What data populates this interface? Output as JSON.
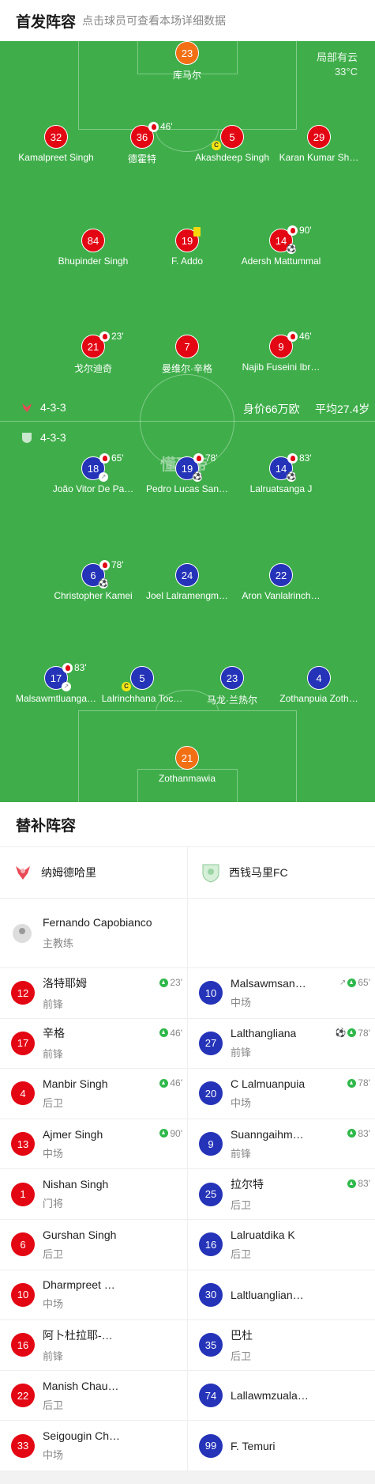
{
  "lineup_header": {
    "title": "首发阵容",
    "hint": "点击球员可查看本场详细数据"
  },
  "field": {
    "weather": "局部有云",
    "temperature": "33°C",
    "watermark": "懂球帝",
    "home_formation": "4-3-3",
    "away_formation": "4-3-3",
    "market_value": "身价66万欧",
    "avg_age": "平均27.4岁"
  },
  "home_players": [
    {
      "num": "23",
      "name": "库马尔"
    },
    {
      "num": "32",
      "name": "Kamalpreet Singh"
    },
    {
      "num": "36",
      "name": "德霍特",
      "sub_min": "46'"
    },
    {
      "num": "5",
      "name": "Akashdeep Singh"
    },
    {
      "num": "29",
      "name": "Karan Kumar Sh…"
    },
    {
      "num": "84",
      "name": "Bhupinder Singh"
    },
    {
      "num": "19",
      "name": "F. Addo"
    },
    {
      "num": "14",
      "name": "Adersh Mattummal",
      "sub_min": "90'"
    },
    {
      "num": "21",
      "name": "戈尔迪奇",
      "sub_min": "23'"
    },
    {
      "num": "7",
      "name": "曼维尔·辛格"
    },
    {
      "num": "9",
      "name": "Najib Fuseini Ibr…",
      "sub_min": "46'"
    }
  ],
  "away_players": [
    {
      "num": "18",
      "name": "João Vitor De Pa…",
      "sub_min": "65'"
    },
    {
      "num": "19",
      "name": "Pedro Lucas San…",
      "sub_min": "78'"
    },
    {
      "num": "14",
      "name": "Lalruatsanga J",
      "sub_min": "83'"
    },
    {
      "num": "6",
      "name": "Christopher Kamei",
      "sub_min": "78'"
    },
    {
      "num": "24",
      "name": "Joel Lalramengm…"
    },
    {
      "num": "22",
      "name": "Aron Vanlalrinch…"
    },
    {
      "num": "17",
      "name": "Malsawmtluanga…",
      "sub_min": "83'"
    },
    {
      "num": "5",
      "name": "Lalrinchhana Toc…"
    },
    {
      "num": "23",
      "name": "马龙·兰热尔"
    },
    {
      "num": "4",
      "name": "Zothanpuia Zoth…"
    },
    {
      "num": "21",
      "name": "Zothanmawia"
    }
  ],
  "bench": {
    "title": "替补阵容",
    "home_team": "纳姆德哈里",
    "away_team": "西钱马里FC",
    "home_coach": {
      "name": "Fernando Capobianco",
      "role": "主教练"
    },
    "rows": [
      {
        "home": {
          "num": "12",
          "name": "洛特耶姆",
          "pos": "前锋",
          "min": "23'"
        },
        "away": {
          "num": "10",
          "name": "Malsawmsan…",
          "pos": "中场",
          "min": "65'"
        }
      },
      {
        "home": {
          "num": "17",
          "name": "辛格",
          "pos": "前锋",
          "min": "46'"
        },
        "away": {
          "num": "27",
          "name": "Lalthangliana",
          "pos": "前锋",
          "min": "78'"
        }
      },
      {
        "home": {
          "num": "4",
          "name": "Manbir Singh",
          "pos": "后卫",
          "min": "46'"
        },
        "away": {
          "num": "20",
          "name": "C Lalmuanpuia",
          "pos": "中场",
          "min": "78'"
        }
      },
      {
        "home": {
          "num": "13",
          "name": "Ajmer Singh",
          "pos": "中场",
          "min": "90'"
        },
        "away": {
          "num": "9",
          "name": "Suanngaihmu…",
          "pos": "前锋",
          "min": "83'"
        }
      },
      {
        "home": {
          "num": "1",
          "name": "Nishan Singh",
          "pos": "门将"
        },
        "away": {
          "num": "25",
          "name": "拉尔特",
          "pos": "后卫",
          "min": "83'"
        }
      },
      {
        "home": {
          "num": "6",
          "name": "Gurshan Singh",
          "pos": "后卫"
        },
        "away": {
          "num": "16",
          "name": "Lalruatdika K",
          "pos": "后卫"
        }
      },
      {
        "home": {
          "num": "10",
          "name": "Dharmpreet …",
          "pos": "中场"
        },
        "away": {
          "num": "30",
          "name": "Laltluangliana…",
          "pos": ""
        }
      },
      {
        "home": {
          "num": "16",
          "name": "阿卜杜拉耶-…",
          "pos": "前锋"
        },
        "away": {
          "num": "35",
          "name": "巴杜",
          "pos": "后卫"
        }
      },
      {
        "home": {
          "num": "22",
          "name": "Manish Chau…",
          "pos": "后卫"
        },
        "away": {
          "num": "74",
          "name": "Lallawmzuala…",
          "pos": ""
        }
      },
      {
        "home": {
          "num": "33",
          "name": "Seigougin Ch…",
          "pos": "中场"
        },
        "away": {
          "num": "99",
          "name": "F. Temuri",
          "pos": ""
        }
      }
    ]
  }
}
